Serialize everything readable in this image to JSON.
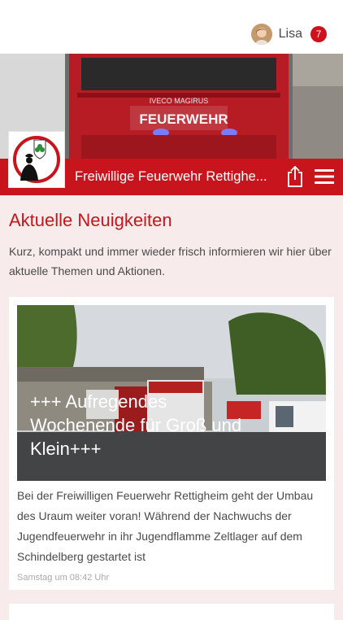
{
  "user": {
    "name": "Lisa",
    "notification_count": "7"
  },
  "header": {
    "title": "Freiwillige Feuerwehr Retttigheim",
    "title_display": "Freiwillige Feuerwehr Rettighe...",
    "share_icon": "share-icon",
    "menu_icon": "hamburger-menu-icon",
    "hero_vehicle_lettering": "FEUERWEHR",
    "hero_brand_lettering": "IVECO MAGIRUS"
  },
  "main": {
    "heading": "Aktuelle Neuigkeiten",
    "intro": "Kurz, kompakt und immer wieder frisch informieren wir hier über aktuelle Themen und Aktionen."
  },
  "news": [
    {
      "title": "+++ Aufregendes Wochenende für Groß und Klein+++",
      "text": "Bei der Freiwilligen Feuerwehr Rettigheim geht der Umbau des Uraum weiter voran! Während der Nachwuchs der Jugendfeuerwehr in ihr Jugendflamme Zeltlager auf dem Schindelberg gestartet ist",
      "time": "Samstag um 08:42 Uhr"
    }
  ],
  "colors": {
    "brand_red": "#c8141c",
    "badge_red": "#d0111b",
    "page_bg": "#f7ebeb"
  }
}
